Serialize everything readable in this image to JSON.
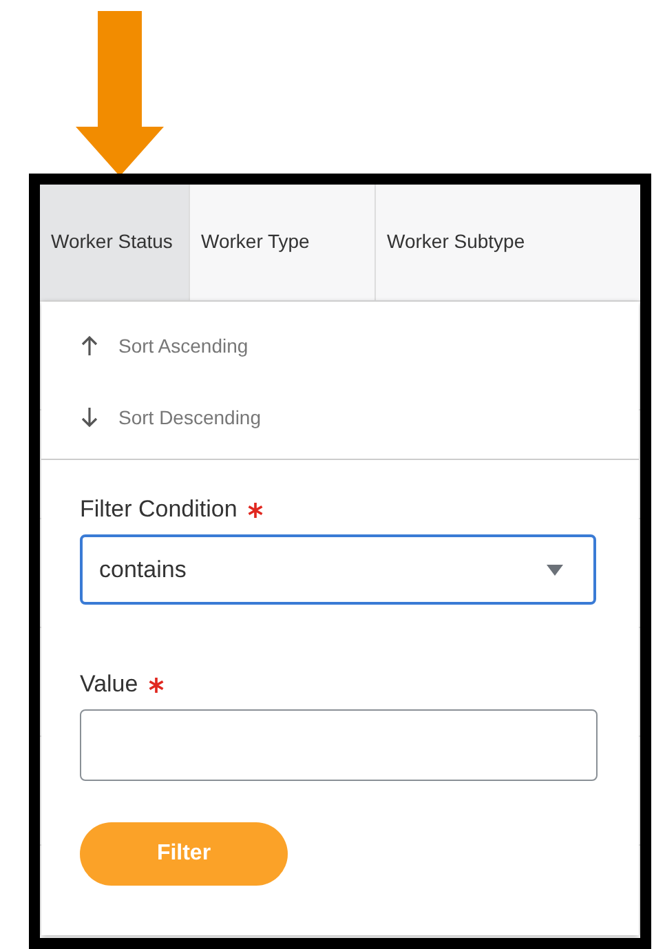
{
  "table": {
    "columns": [
      {
        "label": "Worker Status",
        "selected": true
      },
      {
        "label": "Worker Type",
        "selected": false
      },
      {
        "label": "Worker Subtype",
        "selected": false
      }
    ]
  },
  "column_menu": {
    "sort_options": [
      {
        "kind": "ascending",
        "label": "Sort Ascending"
      },
      {
        "kind": "descending",
        "label": "Sort Descending"
      }
    ],
    "fields": [
      {
        "kind": "select",
        "label": "Filter Condition",
        "required": true,
        "value": "contains",
        "focused": true
      },
      {
        "kind": "text",
        "label": "Value",
        "required": true,
        "focused": false
      }
    ],
    "button": "Filter"
  }
}
